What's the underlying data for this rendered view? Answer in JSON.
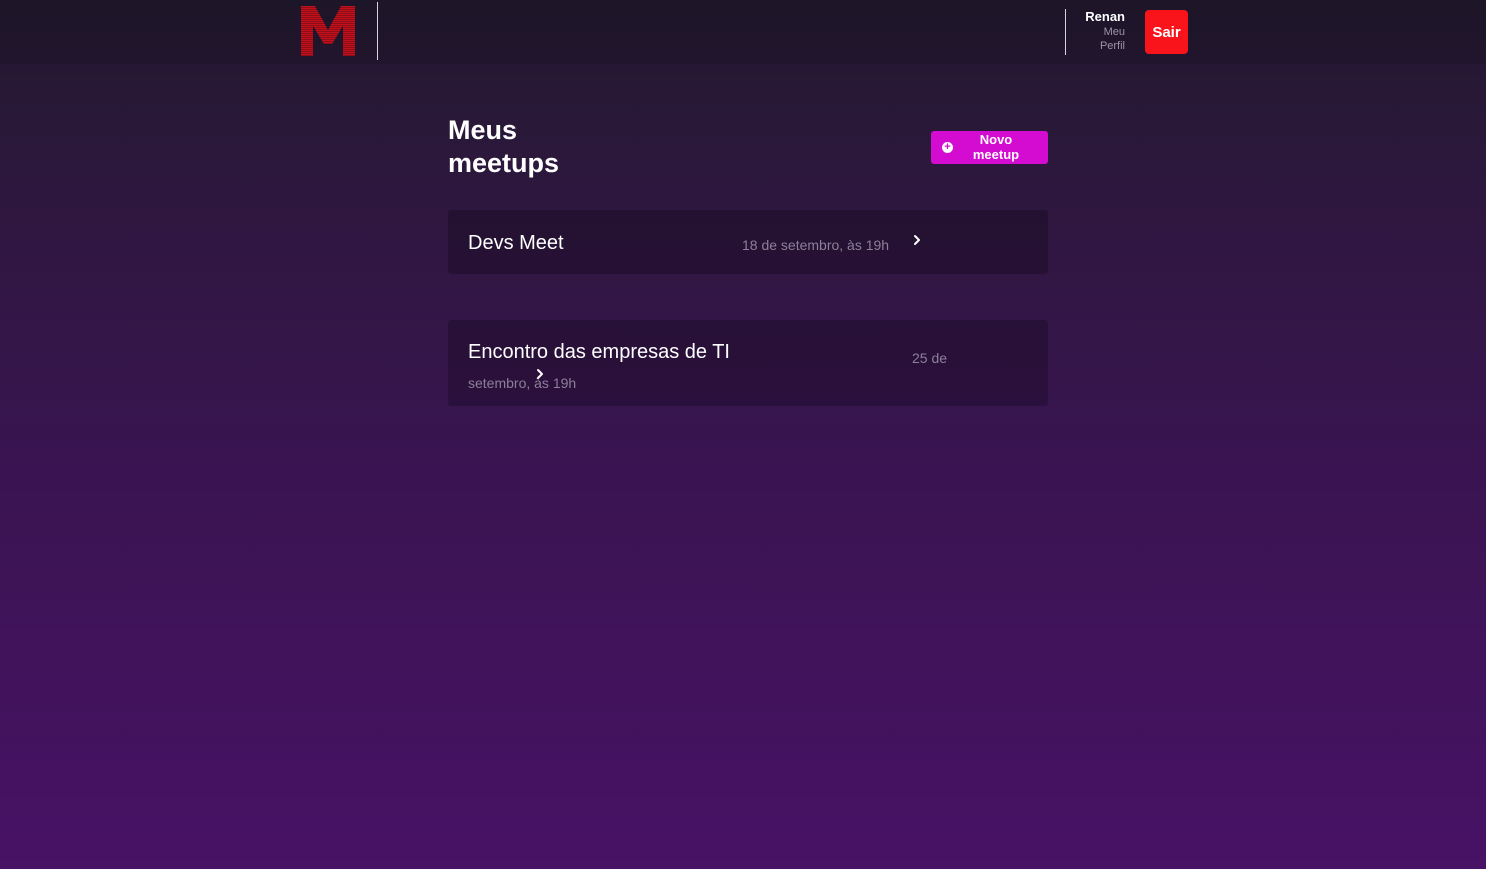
{
  "header": {
    "logo_letter": "M",
    "user_name": "Renan",
    "profile_link": "Meu Perfil",
    "logout_label": "Sair"
  },
  "main": {
    "title": "Meus meetups",
    "new_button_label": "Novo meetup",
    "new_button_icon": "plus-circle-icon",
    "meetups": [
      {
        "title": "Devs Meet",
        "date": "18 de setembro, às 19h"
      },
      {
        "title": "Encontro das empresas de TI",
        "date": "25 de setembro, às 19h"
      }
    ]
  },
  "colors": {
    "accent": "#d40bd1",
    "logout": "#f8141a",
    "logo": "#c2101c"
  }
}
